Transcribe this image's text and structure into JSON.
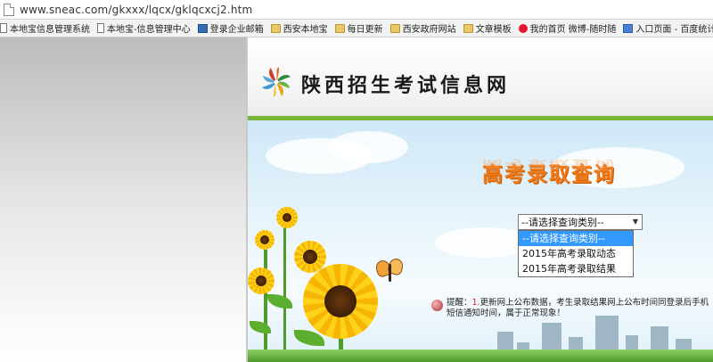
{
  "browser": {
    "url": "www.sneac.com/gkxxx/lqcx/gklqcxcj2.htm",
    "bookmarks": [
      {
        "icon": "page-icon",
        "label": "本地宝信息管理系统"
      },
      {
        "icon": "page-icon",
        "label": "本地宝-信息管理中心"
      },
      {
        "icon": "mail-icon",
        "label": "登录企业邮箱"
      },
      {
        "icon": "folder-icon",
        "label": "西安本地宝"
      },
      {
        "icon": "folder-icon",
        "label": "每日更新"
      },
      {
        "icon": "folder-icon",
        "label": "西安政府网站"
      },
      {
        "icon": "folder-icon",
        "label": "文章模板"
      },
      {
        "icon": "weibo-icon",
        "label": "我的首页 微博-随时随"
      },
      {
        "icon": "chart-icon",
        "label": "入口页面 - 百度统计"
      },
      {
        "icon": "page-icon",
        "label": ""
      }
    ]
  },
  "site": {
    "title": "陕西招生考试信息网"
  },
  "banner": {
    "title": "高考录取查询"
  },
  "query_select": {
    "selected": "--请选择查询类别--",
    "options": [
      "--请选择查询类别--",
      "2015年高考录取动态",
      "2015年高考录取结果"
    ],
    "active_index": 0
  },
  "notice": {
    "lead": "提醒：",
    "highlight": "1.",
    "text": "更新网上公布数据，考生录取结果网上公布时间同登录后手机短信通知时间，属于正常现象！"
  },
  "colors": {
    "accent_green": "#79b53a",
    "title_orange": "#f07a18",
    "option_highlight": "#3399ff"
  }
}
